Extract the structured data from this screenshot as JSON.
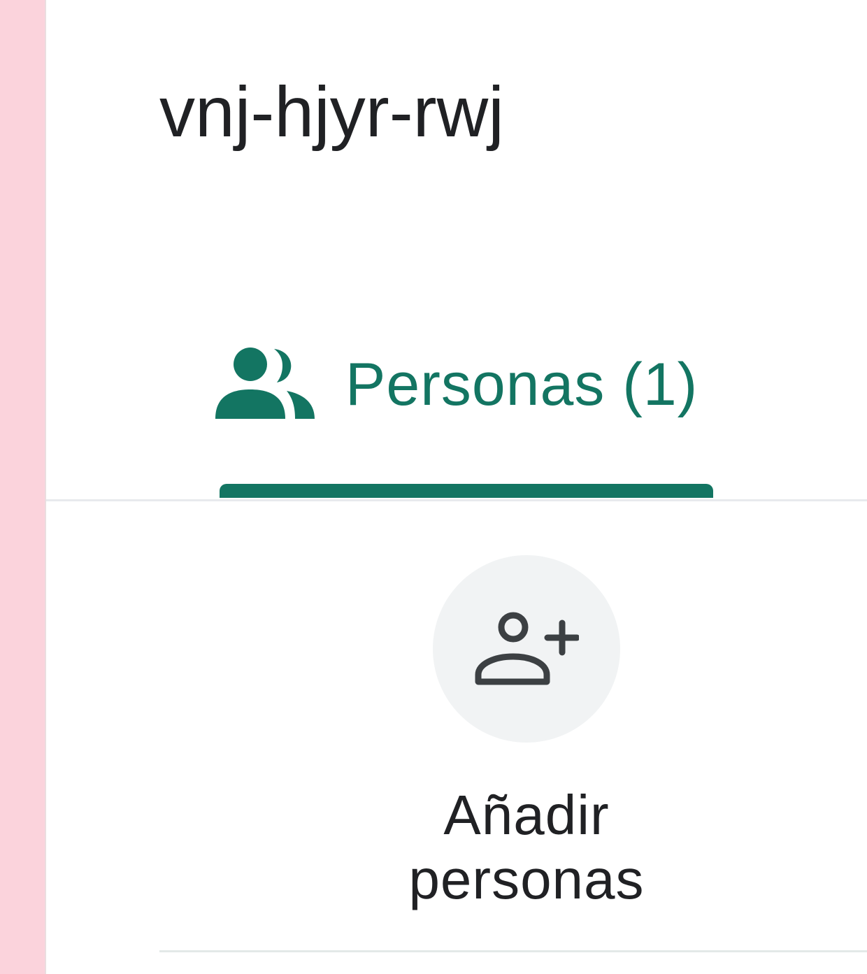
{
  "meeting": {
    "code": "vnj-hjyr-rwj"
  },
  "tabs": [
    {
      "label": "Personas (1)",
      "icon": "people-icon",
      "selected": true
    }
  ],
  "actions": {
    "add_people": {
      "label_line1": "Añadir",
      "label_line2": "personas",
      "icon": "person-add-icon"
    }
  },
  "colors": {
    "accent": "#137562",
    "icon_dark": "#3c4043",
    "text": "#202124",
    "sidebar_strip": "#fbd3dc",
    "circle_bg": "#f1f3f4"
  }
}
